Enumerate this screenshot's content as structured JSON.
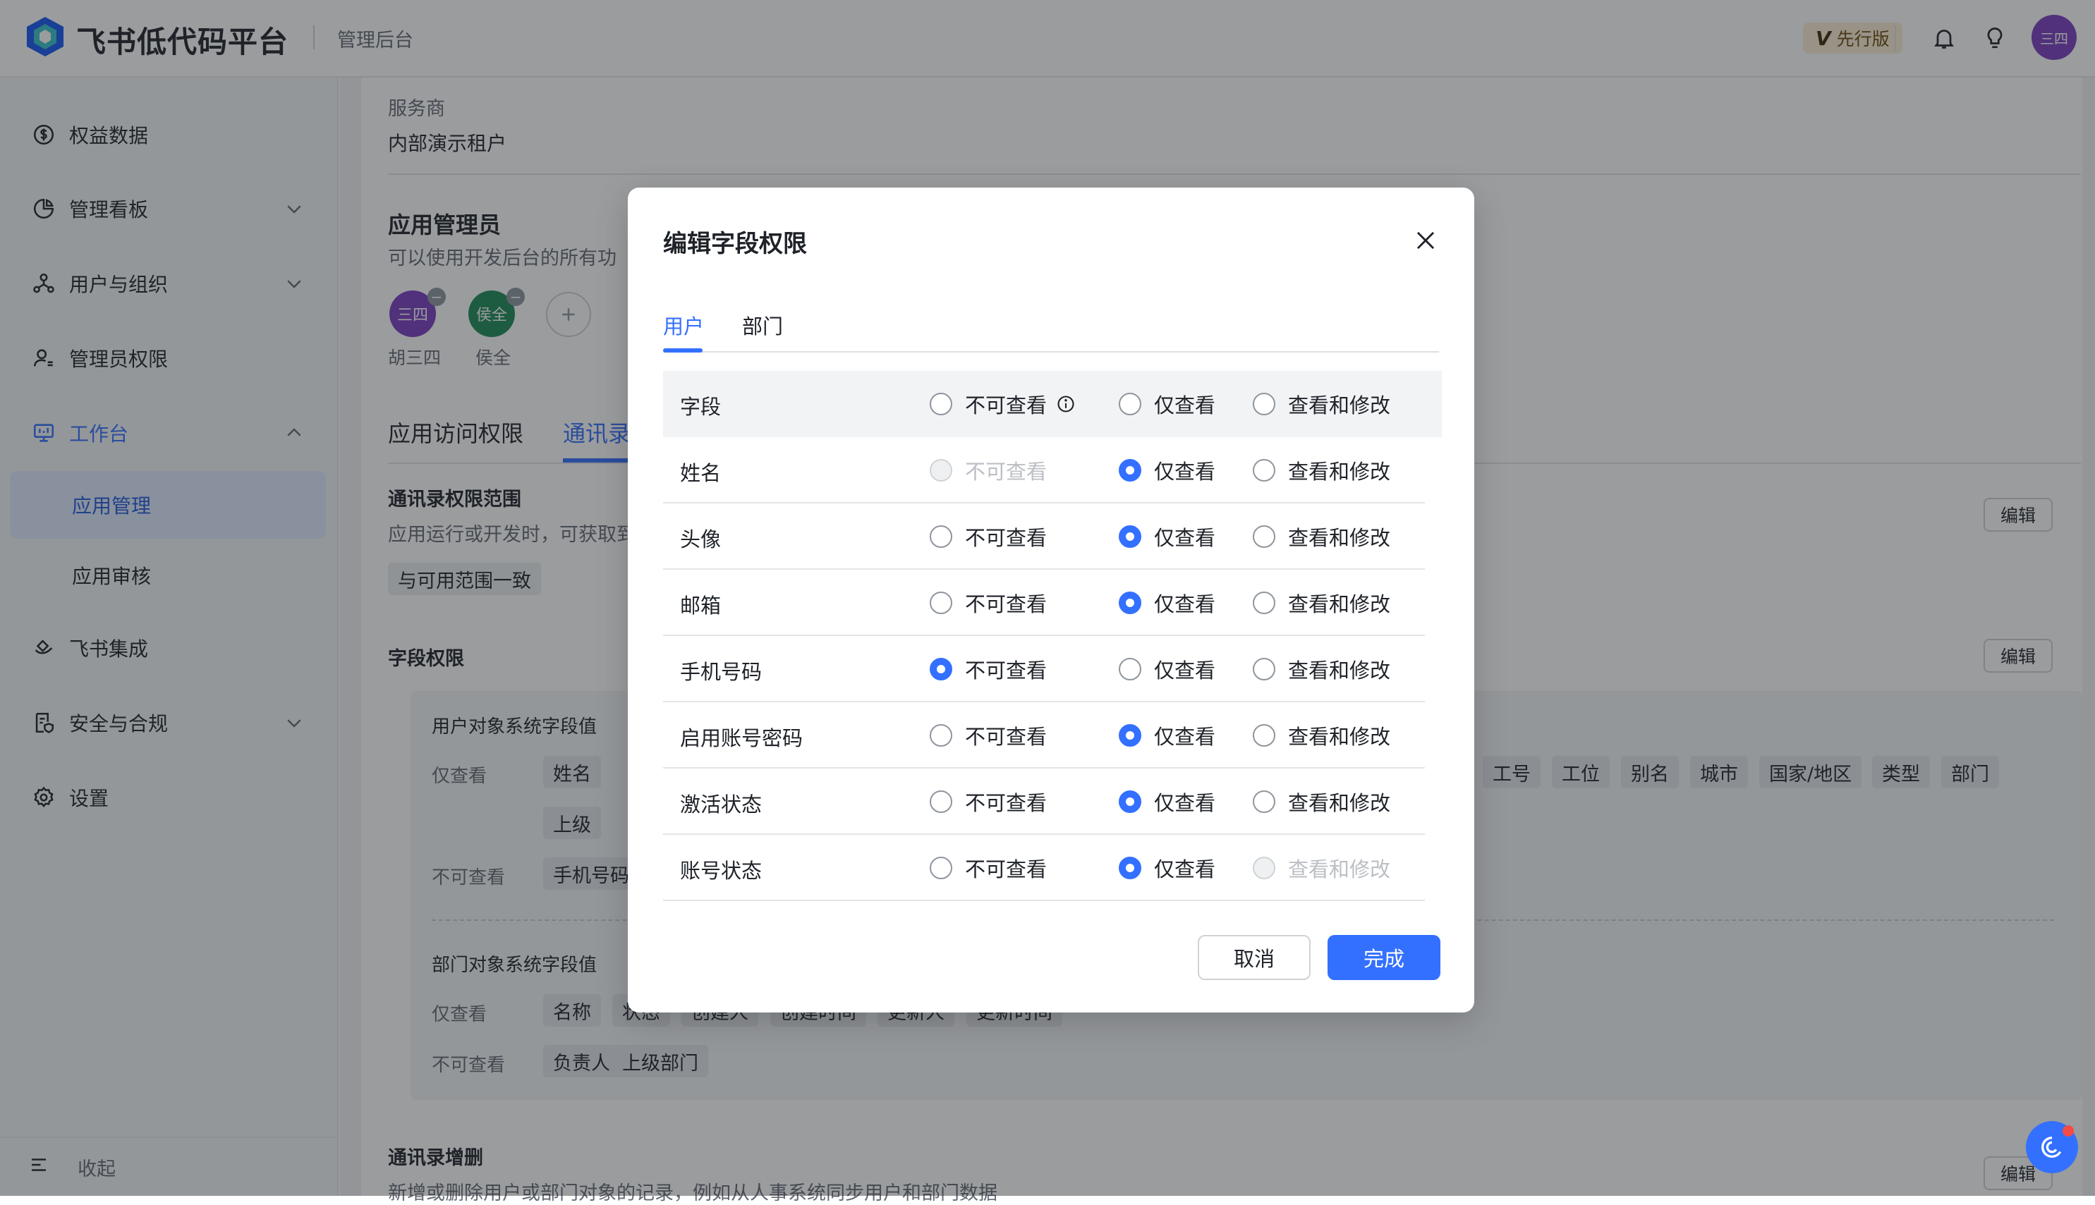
{
  "header": {
    "brand": "飞书低代码平台",
    "sub_brand": "管理后台",
    "edition_mark": "V",
    "edition_label": "先行版",
    "avatar_text": "三四",
    "icons": [
      "bell-icon",
      "bulb-icon"
    ]
  },
  "sidebar": {
    "items": [
      {
        "label": "权益数据",
        "icon": "dollar-circle-icon"
      },
      {
        "label": "管理看板",
        "icon": "pie-chart-icon"
      },
      {
        "label": "用户与组织",
        "icon": "org-icon"
      },
      {
        "label": "管理员权限",
        "icon": "admin-user-icon"
      },
      {
        "label": "工作台",
        "icon": "monitor-icon"
      },
      {
        "label": "飞书集成",
        "icon": "integration-icon"
      },
      {
        "label": "安全与合规",
        "icon": "shield-doc-icon"
      },
      {
        "label": "设置",
        "icon": "gear-icon"
      }
    ],
    "sub_items": [
      "应用管理",
      "应用审核"
    ],
    "collapse_label": "收起"
  },
  "main": {
    "provider_label": "服务商",
    "provider_value": "内部演示租户",
    "admins_title": "应用管理员",
    "admins_desc": "可以使用开发后台的所有功",
    "admins": [
      {
        "initials": "三四",
        "name": "胡三四",
        "color": "#7a3dbf"
      },
      {
        "initials": "侯全",
        "name": "侯全",
        "color": "#1e8a57"
      }
    ],
    "tabs": [
      "应用访问权限",
      "通讯录"
    ],
    "contact_scope_title": "通讯录权限范围",
    "contact_scope_desc": "应用运行或开发时，可获取到",
    "scope_tag": "与可用范围一致",
    "field_perm_title": "字段权限",
    "edit_label": "编辑",
    "user_fields_title": "用户对象系统字段值",
    "view_only_label": "仅查看",
    "not_viewable_label": "不可查看",
    "user_view_tags_left": [
      "姓名"
    ],
    "user_view_tags_right": [
      "工号",
      "工位",
      "别名",
      "城市",
      "国家/地区",
      "类型",
      "部门"
    ],
    "user_view_tags_row2": [
      "上级"
    ],
    "user_hidden_tags": [
      "手机号码"
    ],
    "dept_fields_title": "部门对象系统字段值",
    "dept_view_tags": [
      "名称",
      "状态",
      "创建人",
      "创建时间",
      "更新人",
      "更新时间"
    ],
    "dept_hidden_tags": [
      "负责人",
      "上级部门"
    ],
    "contact_crud_title": "通讯录增删",
    "contact_crud_desc": "新增或删除用户或部门对象的记录，例如从人事系统同步用户和部门数据"
  },
  "modal": {
    "title": "编辑字段权限",
    "tabs": [
      "用户",
      "部门"
    ],
    "active_tab": 0,
    "columns": [
      "字段",
      "不可查看",
      "仅查看",
      "查看和修改"
    ],
    "rows": [
      {
        "field": "姓名",
        "selected": 1,
        "disabled": [
          0
        ]
      },
      {
        "field": "头像",
        "selected": 1,
        "disabled": []
      },
      {
        "field": "邮箱",
        "selected": 1,
        "disabled": []
      },
      {
        "field": "手机号码",
        "selected": 0,
        "disabled": []
      },
      {
        "field": "启用账号密码",
        "selected": 1,
        "disabled": []
      },
      {
        "field": "激活状态",
        "selected": 1,
        "disabled": []
      },
      {
        "field": "账号状态",
        "selected": 1,
        "disabled": [
          2
        ]
      }
    ],
    "cancel_label": "取消",
    "done_label": "完成"
  },
  "colors": {
    "accent": "#3370ff",
    "overlay": "rgba(31,35,41,0.45)"
  }
}
